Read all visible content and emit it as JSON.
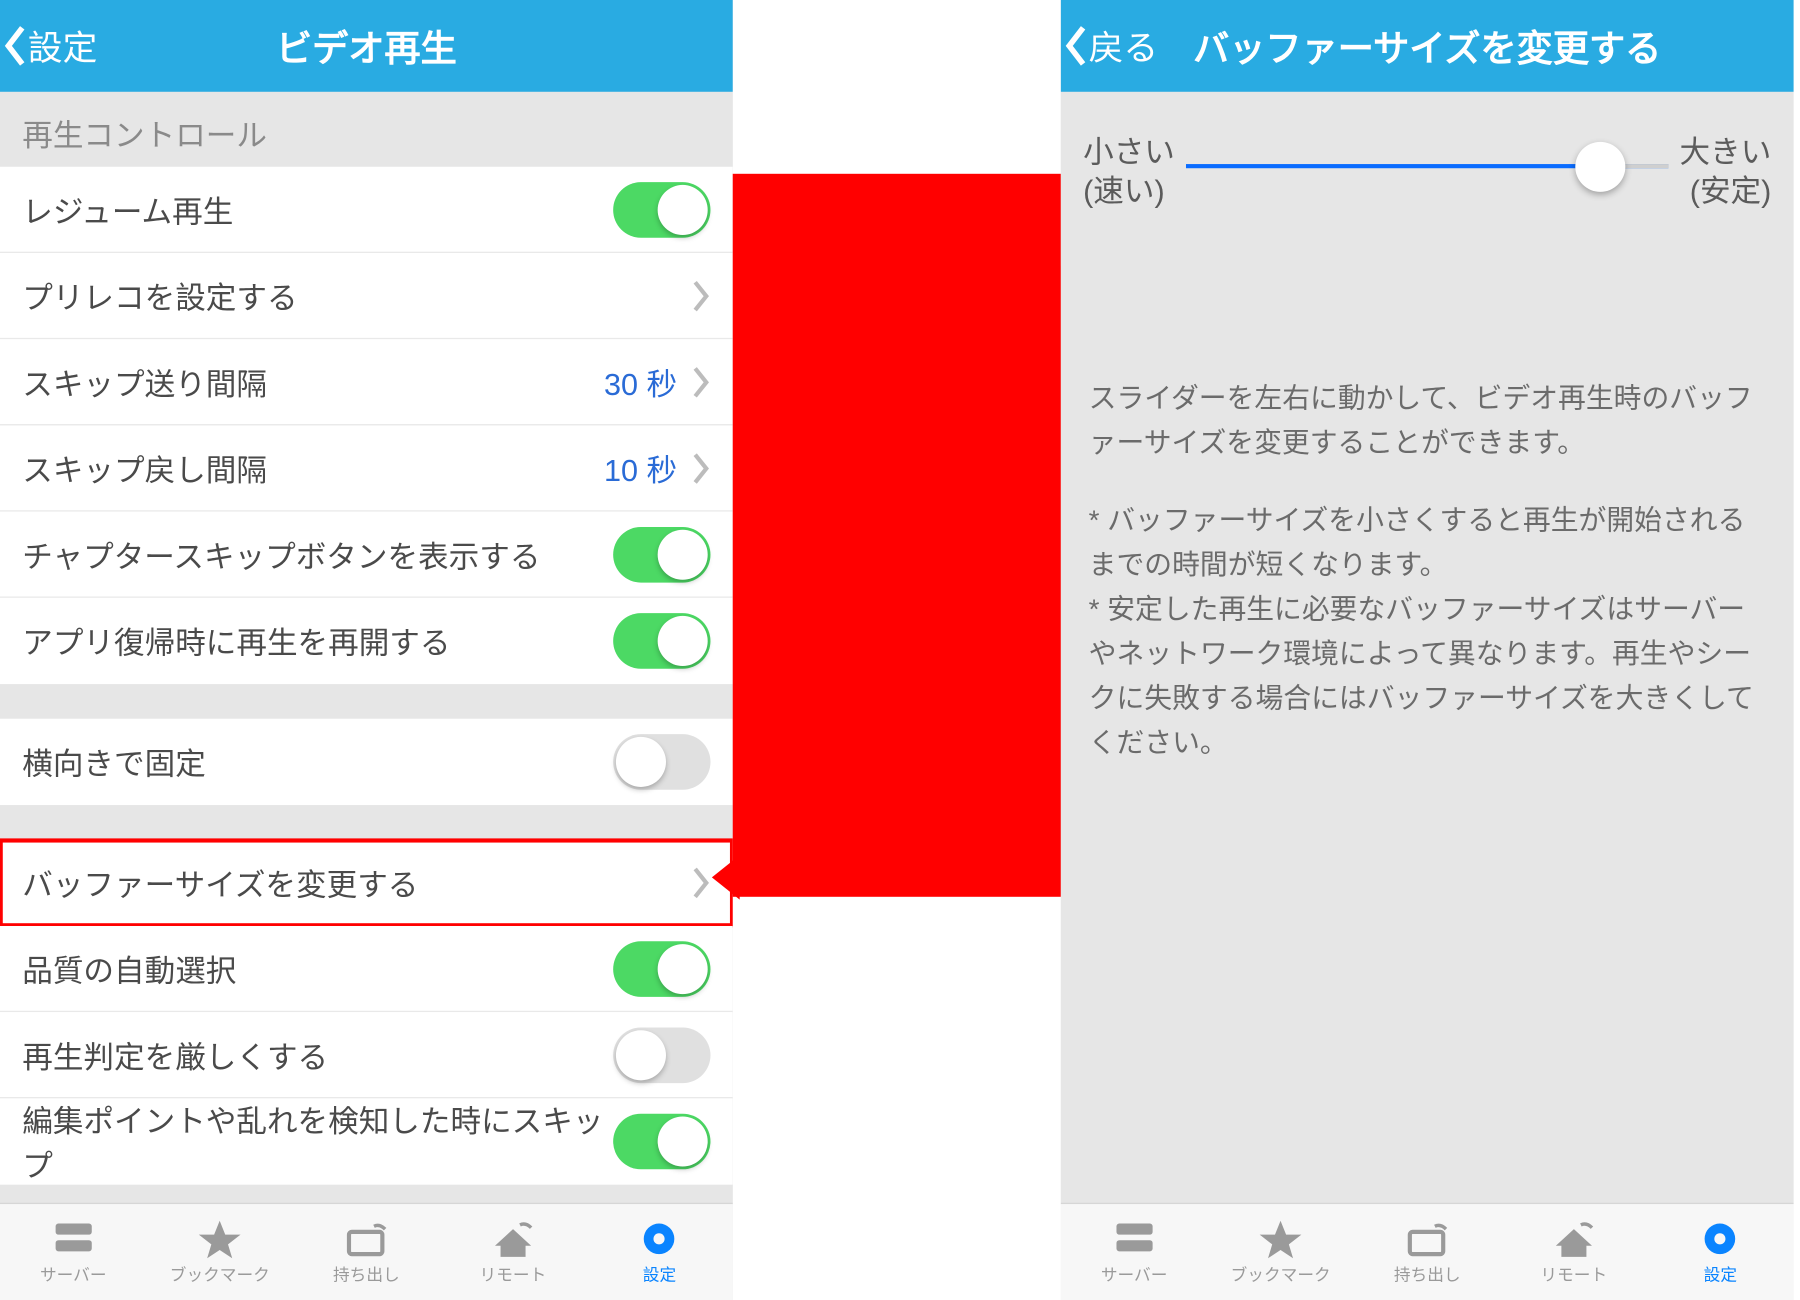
{
  "left": {
    "back_label": "設定",
    "title": "ビデオ再生",
    "section1_label": "再生コントロール",
    "rows": {
      "resume": {
        "label": "レジューム再生"
      },
      "prereco": {
        "label": "プリレコを設定する"
      },
      "skipfwd": {
        "label": "スキップ送り間隔",
        "value": "30 秒"
      },
      "skipbak": {
        "label": "スキップ戻し間隔",
        "value": "10 秒"
      },
      "chapter": {
        "label": "チャプタースキップボタンを表示する"
      },
      "resumeapp": {
        "label": "アプリ復帰時に再生を再開する"
      },
      "landscape": {
        "label": "横向きで固定"
      },
      "buffer": {
        "label": "バッファーサイズを変更する"
      },
      "autoq": {
        "label": "品質の自動選択"
      },
      "strict": {
        "label": "再生判定を厳しくする"
      },
      "editskip": {
        "label": "編集ポイントや乱れを検知した時にスキップ"
      }
    }
  },
  "right": {
    "back_label": "戻る",
    "title": "バッファーサイズを変更する",
    "slider": {
      "left_top": "小さい",
      "left_sub": "(速い)",
      "right_top": "大きい",
      "right_sub": "(安定)"
    },
    "desc1": "スライダーを左右に動かして、ビデオ再生時のバッファーサイズを変更することができます。",
    "desc2": "* バッファーサイズを小さくすると再生が開始されるまでの時間が短くなります。",
    "desc3": "* 安定した再生に必要なバッファーサイズはサーバーやネットワーク環境によって異なります。再生やシークに失敗する場合にはバッファーサイズを大きくしてください。"
  },
  "tabs": {
    "server": "サーバー",
    "bookmark": "ブックマーク",
    "carryout": "持ち出し",
    "remote": "リモート",
    "settings": "設定"
  }
}
